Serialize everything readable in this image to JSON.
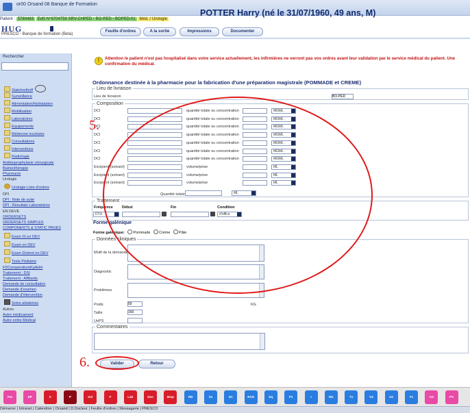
{
  "window": {
    "title": "or00 Orsand 08 Banque de Formation"
  },
  "patient": {
    "name_header": "POTTER Harry (né le 31/07/1960, 49 ans, M)",
    "strip_label": "Patient :",
    "patient_id": "5780483",
    "stay": "EdS N°6704758 SRV-CHPED - BO-PED - BOPED-01",
    "status": "Méd. / Urologie"
  },
  "app": {
    "logo": "HUG",
    "subtitle": "PRESCO - Banque de formation (Beta)"
  },
  "tabs": [
    {
      "label": "Feuille d'ordres"
    },
    {
      "label": "A la sortie"
    },
    {
      "label": "Impressions"
    },
    {
      "label": "Documenter"
    }
  ],
  "sidebar": {
    "search_label": "Rechercher",
    "search_value": "",
    "items": [
      "Statchrothoff",
      "Surveillance",
      "Alimentation/Hydratation",
      "Mobilisation",
      "Laboratoires",
      "Equipements",
      "Médecine nucléaire",
      "Consultations",
      "Interventions",
      "Radiologie",
      "Antibioprophylaxie chirurgicale",
      "Balneothérapie",
      "Pharmacie",
      "Urologie",
      "Urologie Liste d'ordres",
      "DPI",
      "DPI : Note de suite",
      "DPI : Résultats Laboratoires",
      "EN DEVE",
      "ORDERSETS",
      "ORDERSETS SIMPLES",
      "COMPONENTS & STATIC PAGES",
      "Exam IS en DEV",
      "Exam en DEV",
      "Exam Dolorel en DEV",
      "Tests Pédiatrie",
      "FDCompendiumKpAHH",
      "Traitement : DSI",
      "Traitement : Affiliants",
      "Demande de consultation",
      "Demande d'examen",
      "Demande d'intervention",
      "Soins aléatoires",
      "Autres",
      "Autre médicament",
      "Autre ordre Médical"
    ]
  },
  "alert": {
    "text": "Attention le patient n'est pas hospitalisé dans votre service actuellement, les infirmières ne verront pas vos ordres avant leur validation par le service médical du patient. Une confirmation du médical."
  },
  "form": {
    "title": "Ordonnance destinée à la pharmacie pour la fabrication d'une préparation magistrale (POMMADE et CREME)",
    "livraison": {
      "legend": "Lieu de livraison",
      "label": "Lieu de livraison",
      "value": "BO-PED"
    },
    "composition": {
      "legend": "Composition",
      "dci_label": "DCI",
      "excipient_label": "Excipient (solvant)",
      "quantite_label": "quantité totale ou concentration",
      "volume_label": "volume/prise",
      "unit_dci": "MGML",
      "unit_exc": "ML",
      "quantite_totale_label": "Quantité totale",
      "quantite_totale_unit": "ML"
    },
    "traitement": {
      "legend": "Traitement",
      "frequence_label": "Fréquence",
      "debut_label": "Début",
      "fin_label": "Fin",
      "condition_label": "Condition",
      "frequence_value": "DTU",
      "condition_value": "d'office"
    },
    "forme": {
      "legend": "Forme galénique",
      "label": "Forme galénique:",
      "options": [
        "Pommade",
        "Crème",
        "Pâte"
      ]
    },
    "cliniques": {
      "legend": "Données cliniques",
      "motif_label": "Motif de la demande",
      "diagnostic_label": "Diagnostic",
      "problemes_label": "Problèmes",
      "poids_label": "Poids",
      "poids_value": "50",
      "poids_unit": "KG",
      "taille_label": "Taille",
      "taille_value": "160",
      "ueps_label": "UePS"
    },
    "commentaires": {
      "legend": "Commentaires"
    }
  },
  "buttons": {
    "valider": "Valider",
    "retour": "Retour"
  },
  "annotations": {
    "step5": "5.",
    "step6": "6."
  },
  "taskbar": {
    "buttons": [
      {
        "label": "Pat",
        "color": "#e84aa6"
      },
      {
        "label": "DP",
        "color": "#e84aa6"
      },
      {
        "label": "S",
        "color": "#d81c2a"
      },
      {
        "label": "P",
        "color": "#8a0a14"
      },
      {
        "label": "Sol",
        "color": "#d81c2a"
      },
      {
        "label": "F",
        "color": "#d81c2a"
      },
      {
        "label": "Lab",
        "color": "#d81c2a"
      },
      {
        "label": "Doc",
        "color": "#d81c2a"
      },
      {
        "label": "Bmp",
        "color": "#d81c2a"
      },
      {
        "label": "RD",
        "color": "#2a7de0"
      },
      {
        "label": "S1",
        "color": "#2a7de0"
      },
      {
        "label": "D1",
        "color": "#2a7de0"
      },
      {
        "label": "RAD",
        "color": "#2a7de0"
      },
      {
        "label": "Eq",
        "color": "#2a7de0"
      },
      {
        "label": "P1",
        "color": "#2a7de0"
      },
      {
        "label": "I",
        "color": "#2a7de0"
      },
      {
        "label": "W1",
        "color": "#2a7de0"
      },
      {
        "label": "T1",
        "color": "#2a7de0"
      },
      {
        "label": "V4",
        "color": "#2a7de0"
      },
      {
        "label": "U1",
        "color": "#2a7de0"
      },
      {
        "label": "F1",
        "color": "#2a7de0"
      },
      {
        "label": "AD",
        "color": "#e84aa6"
      },
      {
        "label": "PV",
        "color": "#e84aa6"
      }
    ],
    "winbar_text": "Démarrer | Intranet | Calendrier | Orsand | D.Docteur | Feuille d'ordres | Messagerie | PRESCO"
  }
}
